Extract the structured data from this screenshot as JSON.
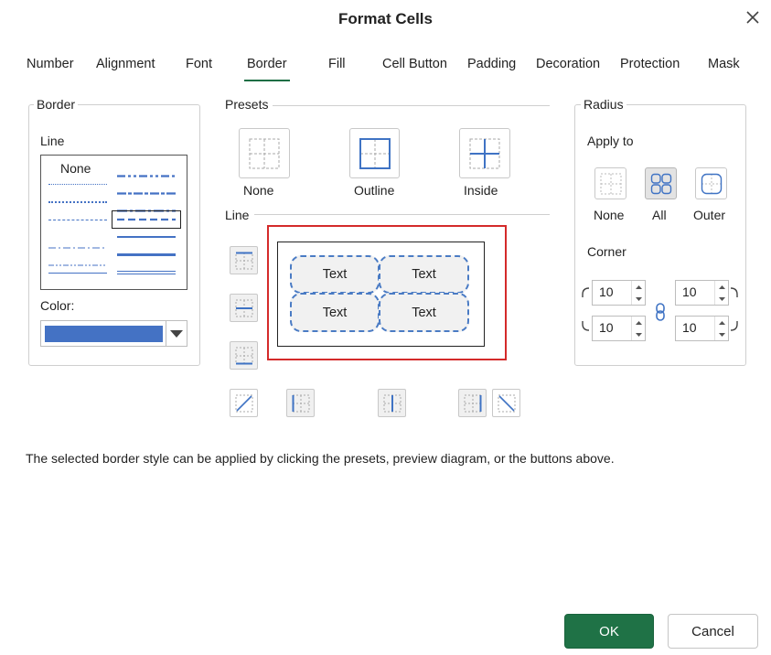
{
  "dialog": {
    "title": "Format Cells",
    "close_label": "×"
  },
  "tabs": [
    {
      "label": "Number"
    },
    {
      "label": "Alignment"
    },
    {
      "label": "Font"
    },
    {
      "label": "Border",
      "active": true
    },
    {
      "label": "Fill"
    },
    {
      "label": "Cell Button"
    },
    {
      "label": "Padding"
    },
    {
      "label": "Decoration"
    },
    {
      "label": "Protection"
    },
    {
      "label": "Mask"
    }
  ],
  "border_panel": {
    "legend": "Border",
    "line_label": "Line",
    "none_style_label": "None",
    "selected_style": "dash",
    "color_label": "Color:",
    "color_value": "#4472c4"
  },
  "presets": {
    "legend": "Presets",
    "items": [
      {
        "label": "None"
      },
      {
        "label": "Outline"
      },
      {
        "label": "Inside"
      }
    ]
  },
  "line_section": {
    "label": "Line"
  },
  "preview": {
    "cells": [
      {
        "text": "Text"
      },
      {
        "text": "Text"
      },
      {
        "text": "Text"
      },
      {
        "text": "Text"
      }
    ],
    "border_color": "#4a7bc4",
    "highlight_color": "#d42a2a"
  },
  "radius": {
    "legend": "Radius",
    "apply_to_label": "Apply to",
    "apply_options": [
      {
        "label": "None"
      },
      {
        "label": "All",
        "selected": true
      },
      {
        "label": "Outer"
      }
    ],
    "corner_label": "Corner",
    "top_left": "10",
    "top_right": "10",
    "bottom_left": "10",
    "bottom_right": "10"
  },
  "hint": "The selected border style can be applied by clicking the presets, preview diagram, or the buttons above.",
  "buttons": {
    "ok": "OK",
    "cancel": "Cancel"
  },
  "colors": {
    "accent": "#1f7246",
    "line_blue": "#4472c4"
  }
}
